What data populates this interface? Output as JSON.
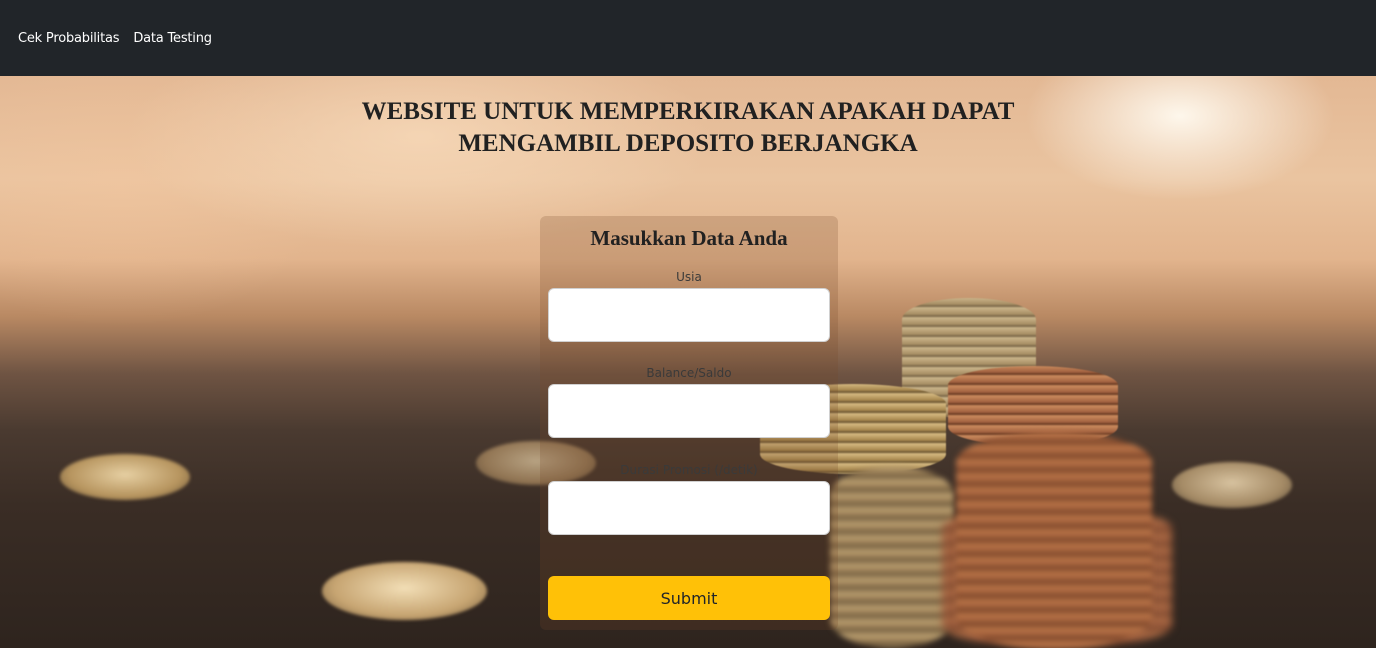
{
  "navbar": {
    "links": [
      {
        "label": "Cek Probabilitas"
      },
      {
        "label": "Data Testing"
      }
    ],
    "background": "#212529"
  },
  "hero": {
    "title": "WEBSITE UNTUK MEMPERKIRAKAN APAKAH DAPAT\nMENGAMBIL DEPOSITO BERJANGKA"
  },
  "form": {
    "heading": "Masukkan Data Anda",
    "fields": [
      {
        "label": "Usia",
        "value": "",
        "placeholder": ""
      },
      {
        "label": "Balance/Saldo",
        "value": "",
        "placeholder": ""
      },
      {
        "label": "Durasi Promosi (/detik)",
        "value": "",
        "placeholder": ""
      }
    ],
    "submit_label": "Submit",
    "submit_color": "#ffc107"
  }
}
